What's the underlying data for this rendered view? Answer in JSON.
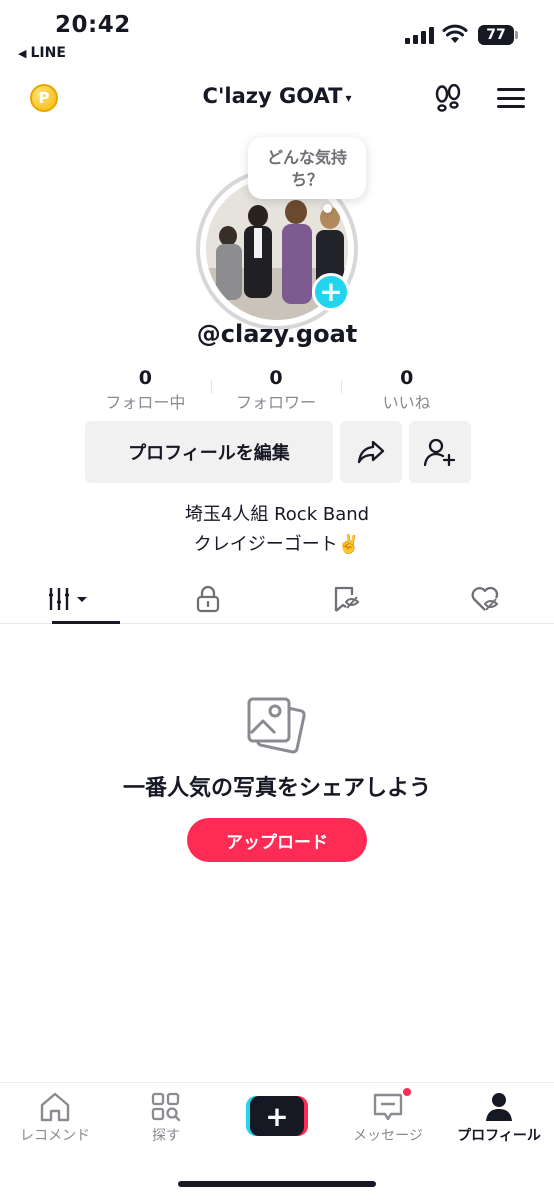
{
  "status_bar": {
    "time": "20:42",
    "back_app": "LINE",
    "battery": "77"
  },
  "header": {
    "coin_letter": "P",
    "account_name": "C'lazy GOAT",
    "chevron": "⌄"
  },
  "profile": {
    "story_prompt": "どんな気持ち？",
    "add_symbol": "+",
    "username": "@clazy.goat",
    "stats": [
      {
        "value": "0",
        "label": "フォロー中"
      },
      {
        "value": "0",
        "label": "フォロワー"
      },
      {
        "value": "0",
        "label": "いいね"
      }
    ],
    "edit_button_label": "プロフィールを編集",
    "bio_line1": "埼玉4人組 Rock Band",
    "bio_line2": "クレイジーゴート✌️"
  },
  "tabs": [
    {
      "icon": "grid-columns-icon",
      "active": true
    },
    {
      "icon": "lock-icon",
      "active": false
    },
    {
      "icon": "bookmark-icon",
      "active": false
    },
    {
      "icon": "liked-hidden-icon",
      "active": false
    }
  ],
  "empty_state": {
    "title": "一番人気の写真をシェアしよう",
    "upload_label": "アップロード"
  },
  "bottom_nav": {
    "items": [
      {
        "label": "レコメンド",
        "icon": "home-icon"
      },
      {
        "label": "探す",
        "icon": "explore-icon"
      },
      {
        "label": "",
        "icon": "create-icon"
      },
      {
        "label": "メッセージ",
        "icon": "inbox-icon"
      },
      {
        "label": "プロフィール",
        "icon": "profile-icon"
      }
    ],
    "create_symbol": "+"
  },
  "colors": {
    "accent_red": "#fe2c55",
    "accent_cyan": "#20d5ec",
    "text": "#161823",
    "muted": "#8a8b91"
  }
}
